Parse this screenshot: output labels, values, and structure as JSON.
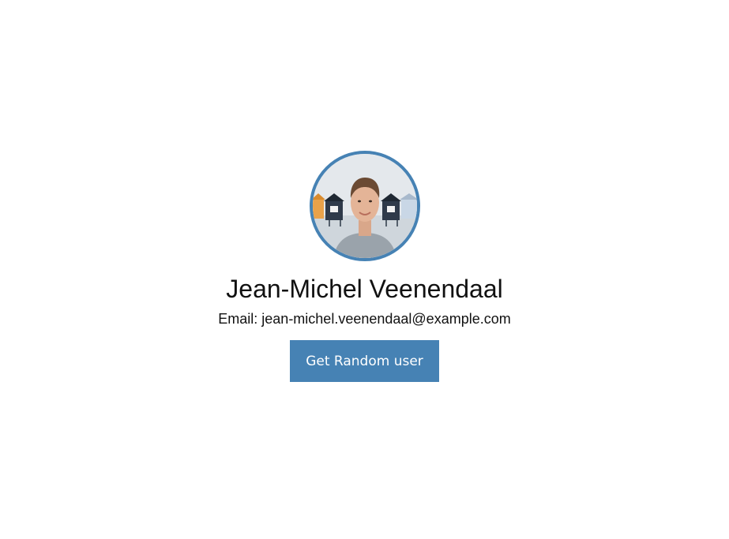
{
  "user": {
    "name": "Jean-Michel Veenendaal",
    "email_label": "Email:",
    "email": "jean-michel.veenendaal@example.com"
  },
  "actions": {
    "random_button_label": "Get Random user"
  },
  "colors": {
    "accent": "#4682b4",
    "button_text": "#ffffff",
    "text": "#111111",
    "background": "#ffffff"
  }
}
